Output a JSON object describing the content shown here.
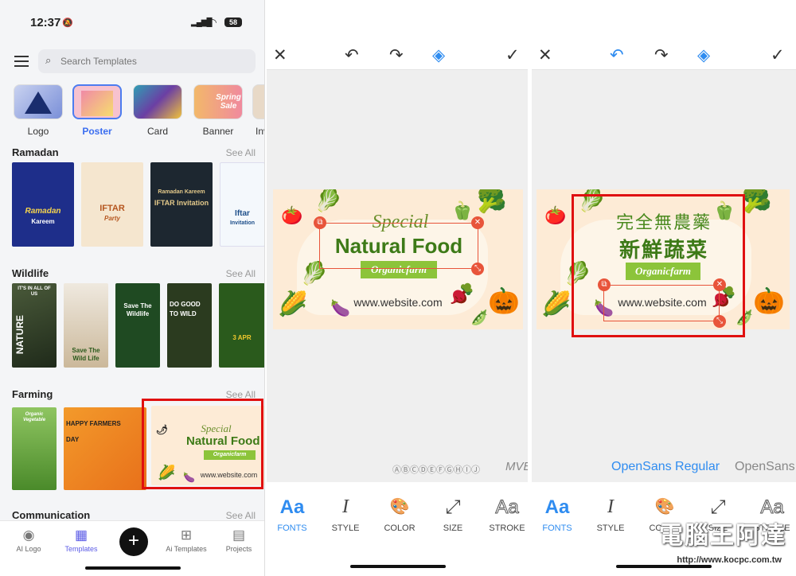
{
  "status": {
    "time": "12:37",
    "battery": "58"
  },
  "search": {
    "placeholder": "Search Templates"
  },
  "categories": [
    {
      "label": "Logo"
    },
    {
      "label": "Poster"
    },
    {
      "label": "Card"
    },
    {
      "label": "Banner"
    },
    {
      "label": "Inv"
    }
  ],
  "sections": [
    {
      "title": "Ramadan",
      "see_all": "See All",
      "cards": [
        {
          "l1": "Ramadan",
          "l2": "Kareem"
        },
        {
          "l1": "IFTAR",
          "l2": "Party"
        },
        {
          "l1": "Ramadan Kareem",
          "l2": "IFTAR Invitation"
        },
        {
          "l1": "Iftar",
          "l2": "Invitation"
        }
      ]
    },
    {
      "title": "Wildlife",
      "see_all": "See All",
      "cards": [
        {
          "l1": "NATURE",
          "l2": "IT'S IN ALL OF US"
        },
        {
          "l1": "Save The",
          "l2": "Wild Life"
        },
        {
          "l1": "Save The",
          "l2": "Wildlife"
        },
        {
          "l1": "DO GOOD",
          "l2": "TO WILD"
        },
        {
          "l1": "3 APR",
          "l2": ""
        }
      ]
    },
    {
      "title": "Farming",
      "see_all": "See All",
      "cards": [
        {
          "l1": "Organic Vegetable",
          "l2": ""
        },
        {
          "l1": "HAPPY FARMERS",
          "l2": "DAY"
        },
        {
          "l1": "Special",
          "l2": "Natural Food"
        }
      ]
    },
    {
      "title": "Communication",
      "see_all": "See All",
      "cards": []
    }
  ],
  "featured_card": {
    "special": "Special",
    "title": "Natural Food",
    "tag": "Organicfarm",
    "web": "www.website.com"
  },
  "bottom_nav": [
    {
      "label": "AI Logo",
      "icon": "ai-logo-icon"
    },
    {
      "label": "Templates",
      "icon": "templates-icon"
    },
    {
      "label": "",
      "icon": "plus-icon"
    },
    {
      "label": "Ai Templates",
      "icon": "ai-templates-icon"
    },
    {
      "label": "Projects",
      "icon": "projects-icon"
    }
  ],
  "editor_banner": {
    "special": "Special",
    "title": "Natural Food",
    "tag": "Organicfarm",
    "website": "www.website.com",
    "cn_line1": "完全無農藥",
    "cn_line2": "新鮮蔬菜"
  },
  "font_row": {
    "first": "ⒶⒷⒸⒹⒺⒻⒼⒽⒾⒿ",
    "second": "MVEnSans Light",
    "third": "OpenSans Regular",
    "fourth": "OpenSans"
  },
  "tools": [
    {
      "label": "FONTS",
      "glyph": "Aa"
    },
    {
      "label": "STYLE",
      "glyph": "I"
    },
    {
      "label": "COLOR",
      "glyph": "🎨"
    },
    {
      "label": "SIZE",
      "glyph": "⤢"
    },
    {
      "label": "STROKE",
      "glyph": "Aa"
    }
  ],
  "watermark": {
    "title": "電腦王阿達",
    "url": "http://www.kocpc.com.tw"
  },
  "colors": {
    "accent": "#2f8cf0",
    "highlight": "#e01010",
    "brand_green": "#3d7a17"
  }
}
